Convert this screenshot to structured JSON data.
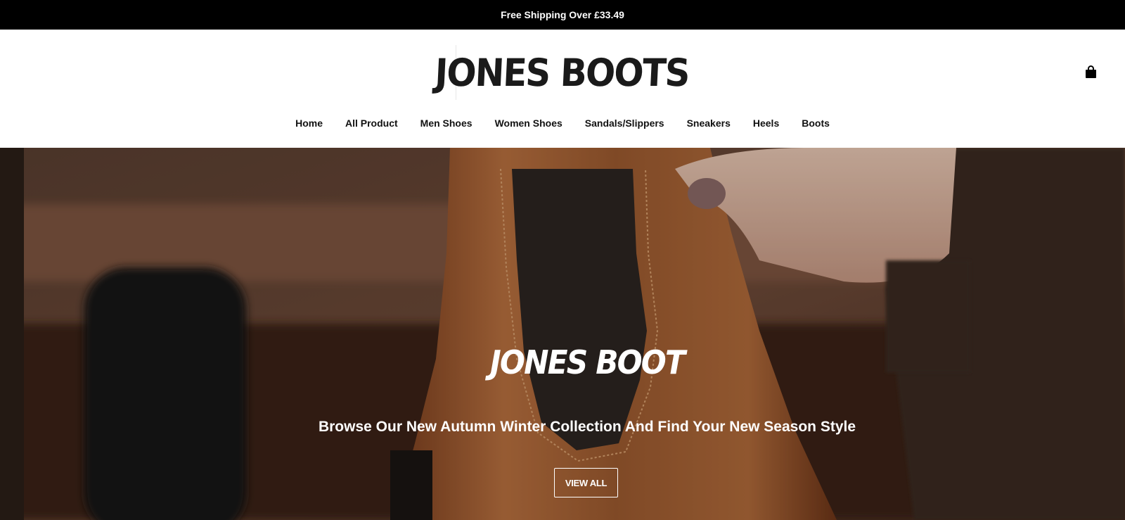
{
  "announcement": {
    "text": "Free Shipping Over £33.49"
  },
  "header": {
    "logo_text": "JONES BOOTS",
    "cart_icon": "shopping-bag-icon"
  },
  "nav": {
    "items": [
      {
        "label": "Home"
      },
      {
        "label": "All Product"
      },
      {
        "label": "Men Shoes"
      },
      {
        "label": "Women Shoes"
      },
      {
        "label": "Sandals/Slippers"
      },
      {
        "label": "Sneakers"
      },
      {
        "label": "Heels"
      },
      {
        "label": "Boots"
      }
    ]
  },
  "hero": {
    "title": "JONES BOOT",
    "subtitle": "Browse Our New Autumn Winter Collection And Find Your New Season Style",
    "button_label": "VIEW ALL"
  },
  "colors": {
    "announcement_bg": "#000000",
    "header_bg": "#ffffff",
    "text": "#111111",
    "hero_text": "#ffffff"
  }
}
